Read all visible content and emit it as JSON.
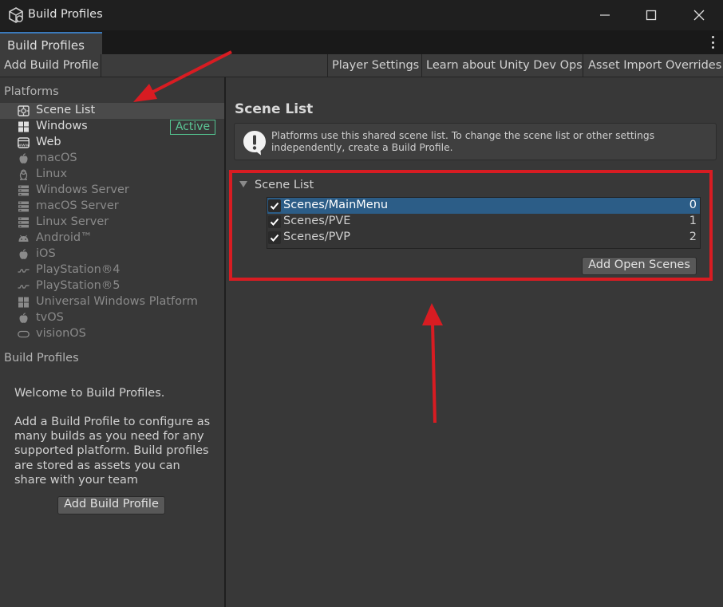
{
  "window": {
    "title": "Build Profiles"
  },
  "tabs": [
    {
      "label": "Build Profiles"
    }
  ],
  "toolbar": {
    "add_build_profile": "Add Build Profile",
    "player_settings": "Player Settings",
    "learn_devops": "Learn about Unity Dev Ops",
    "asset_import_overrides": "Asset Import Overrides"
  },
  "sidebar": {
    "platforms_label": "Platforms",
    "platforms": [
      {
        "label": "Scene List",
        "icon": "scene-list-icon",
        "state": "selected"
      },
      {
        "label": "Windows",
        "icon": "windows-icon",
        "state": "on",
        "badge": "Active"
      },
      {
        "label": "Web",
        "icon": "web-icon",
        "state": "on"
      },
      {
        "label": "macOS",
        "icon": "apple-icon",
        "state": "off"
      },
      {
        "label": "Linux",
        "icon": "linux-icon",
        "state": "off"
      },
      {
        "label": "Windows Server",
        "icon": "server-icon",
        "state": "off"
      },
      {
        "label": "macOS Server",
        "icon": "server-icon",
        "state": "off"
      },
      {
        "label": "Linux Server",
        "icon": "server-icon",
        "state": "off"
      },
      {
        "label": "Android™",
        "icon": "android-icon",
        "state": "off"
      },
      {
        "label": "iOS",
        "icon": "apple-icon",
        "state": "off"
      },
      {
        "label": "PlayStation®4",
        "icon": "playstation-icon",
        "state": "off"
      },
      {
        "label": "PlayStation®5",
        "icon": "playstation-icon",
        "state": "off"
      },
      {
        "label": "Universal Windows Platform",
        "icon": "windows-icon",
        "state": "off"
      },
      {
        "label": "tvOS",
        "icon": "apple-icon",
        "state": "off"
      },
      {
        "label": "visionOS",
        "icon": "visionos-icon",
        "state": "off"
      }
    ],
    "build_profiles_label": "Build Profiles",
    "welcome_title": "Welcome to Build Profiles.",
    "welcome_body": "Add a Build Profile to configure as many builds as you need for any supported platform. Build profiles are stored as assets you can share with your team",
    "add_build_profile_button": "Add Build Profile"
  },
  "main": {
    "title": "Scene List",
    "info_text": "Platforms use this shared scene list. To change the scene list or other settings independently, create a Build Profile.",
    "foldout_label": "Scene List",
    "scenes": [
      {
        "name": "Scenes/MainMenu",
        "index": "0",
        "checked": true,
        "selected": true
      },
      {
        "name": "Scenes/PVE",
        "index": "1",
        "checked": true,
        "selected": false
      },
      {
        "name": "Scenes/PVP",
        "index": "2",
        "checked": true,
        "selected": false
      }
    ],
    "add_open_scenes_button": "Add Open Scenes"
  },
  "colors": {
    "annotation_red": "#d81c22",
    "selection_blue": "#2c5d87",
    "active_green": "#53c28f",
    "tab_accent": "#3a79bb"
  }
}
